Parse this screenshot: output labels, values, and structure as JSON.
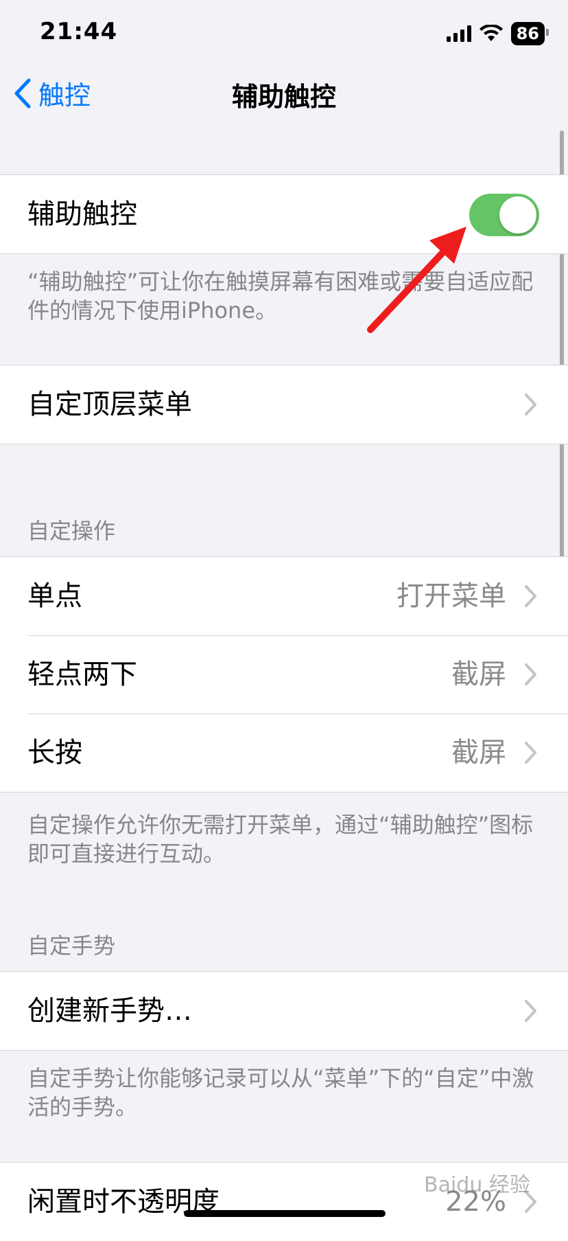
{
  "status_bar": {
    "time": "21:44",
    "battery": "86"
  },
  "nav": {
    "back_label": "触控",
    "title": "辅助触控"
  },
  "assistive_touch": {
    "label": "辅助触控",
    "enabled": true,
    "description": "“辅助触控”可让你在触摸屏幕有困难或需要自适应配件的情况下使用iPhone。"
  },
  "top_menu": {
    "label": "自定顶层菜单"
  },
  "custom_actions": {
    "header": "自定操作",
    "rows": [
      {
        "label": "单点",
        "value": "打开菜单"
      },
      {
        "label": "轻点两下",
        "value": "截屏"
      },
      {
        "label": "长按",
        "value": "截屏"
      }
    ],
    "footer": "自定操作允许你无需打开菜单，通过“辅助触控”图标即可直接进行互动。"
  },
  "custom_gestures": {
    "header": "自定手势",
    "create_label": "创建新手势…",
    "footer": "自定手势让你能够记录可以从“菜单”下的“自定”中激活的手势。"
  },
  "idle_opacity": {
    "label": "闲置时不透明度",
    "value": "22%"
  },
  "watermark": "Baidu 经验",
  "colors": {
    "accent": "#007aff",
    "toggle_on": "#65c466",
    "arrow": "#ee1d1d"
  }
}
